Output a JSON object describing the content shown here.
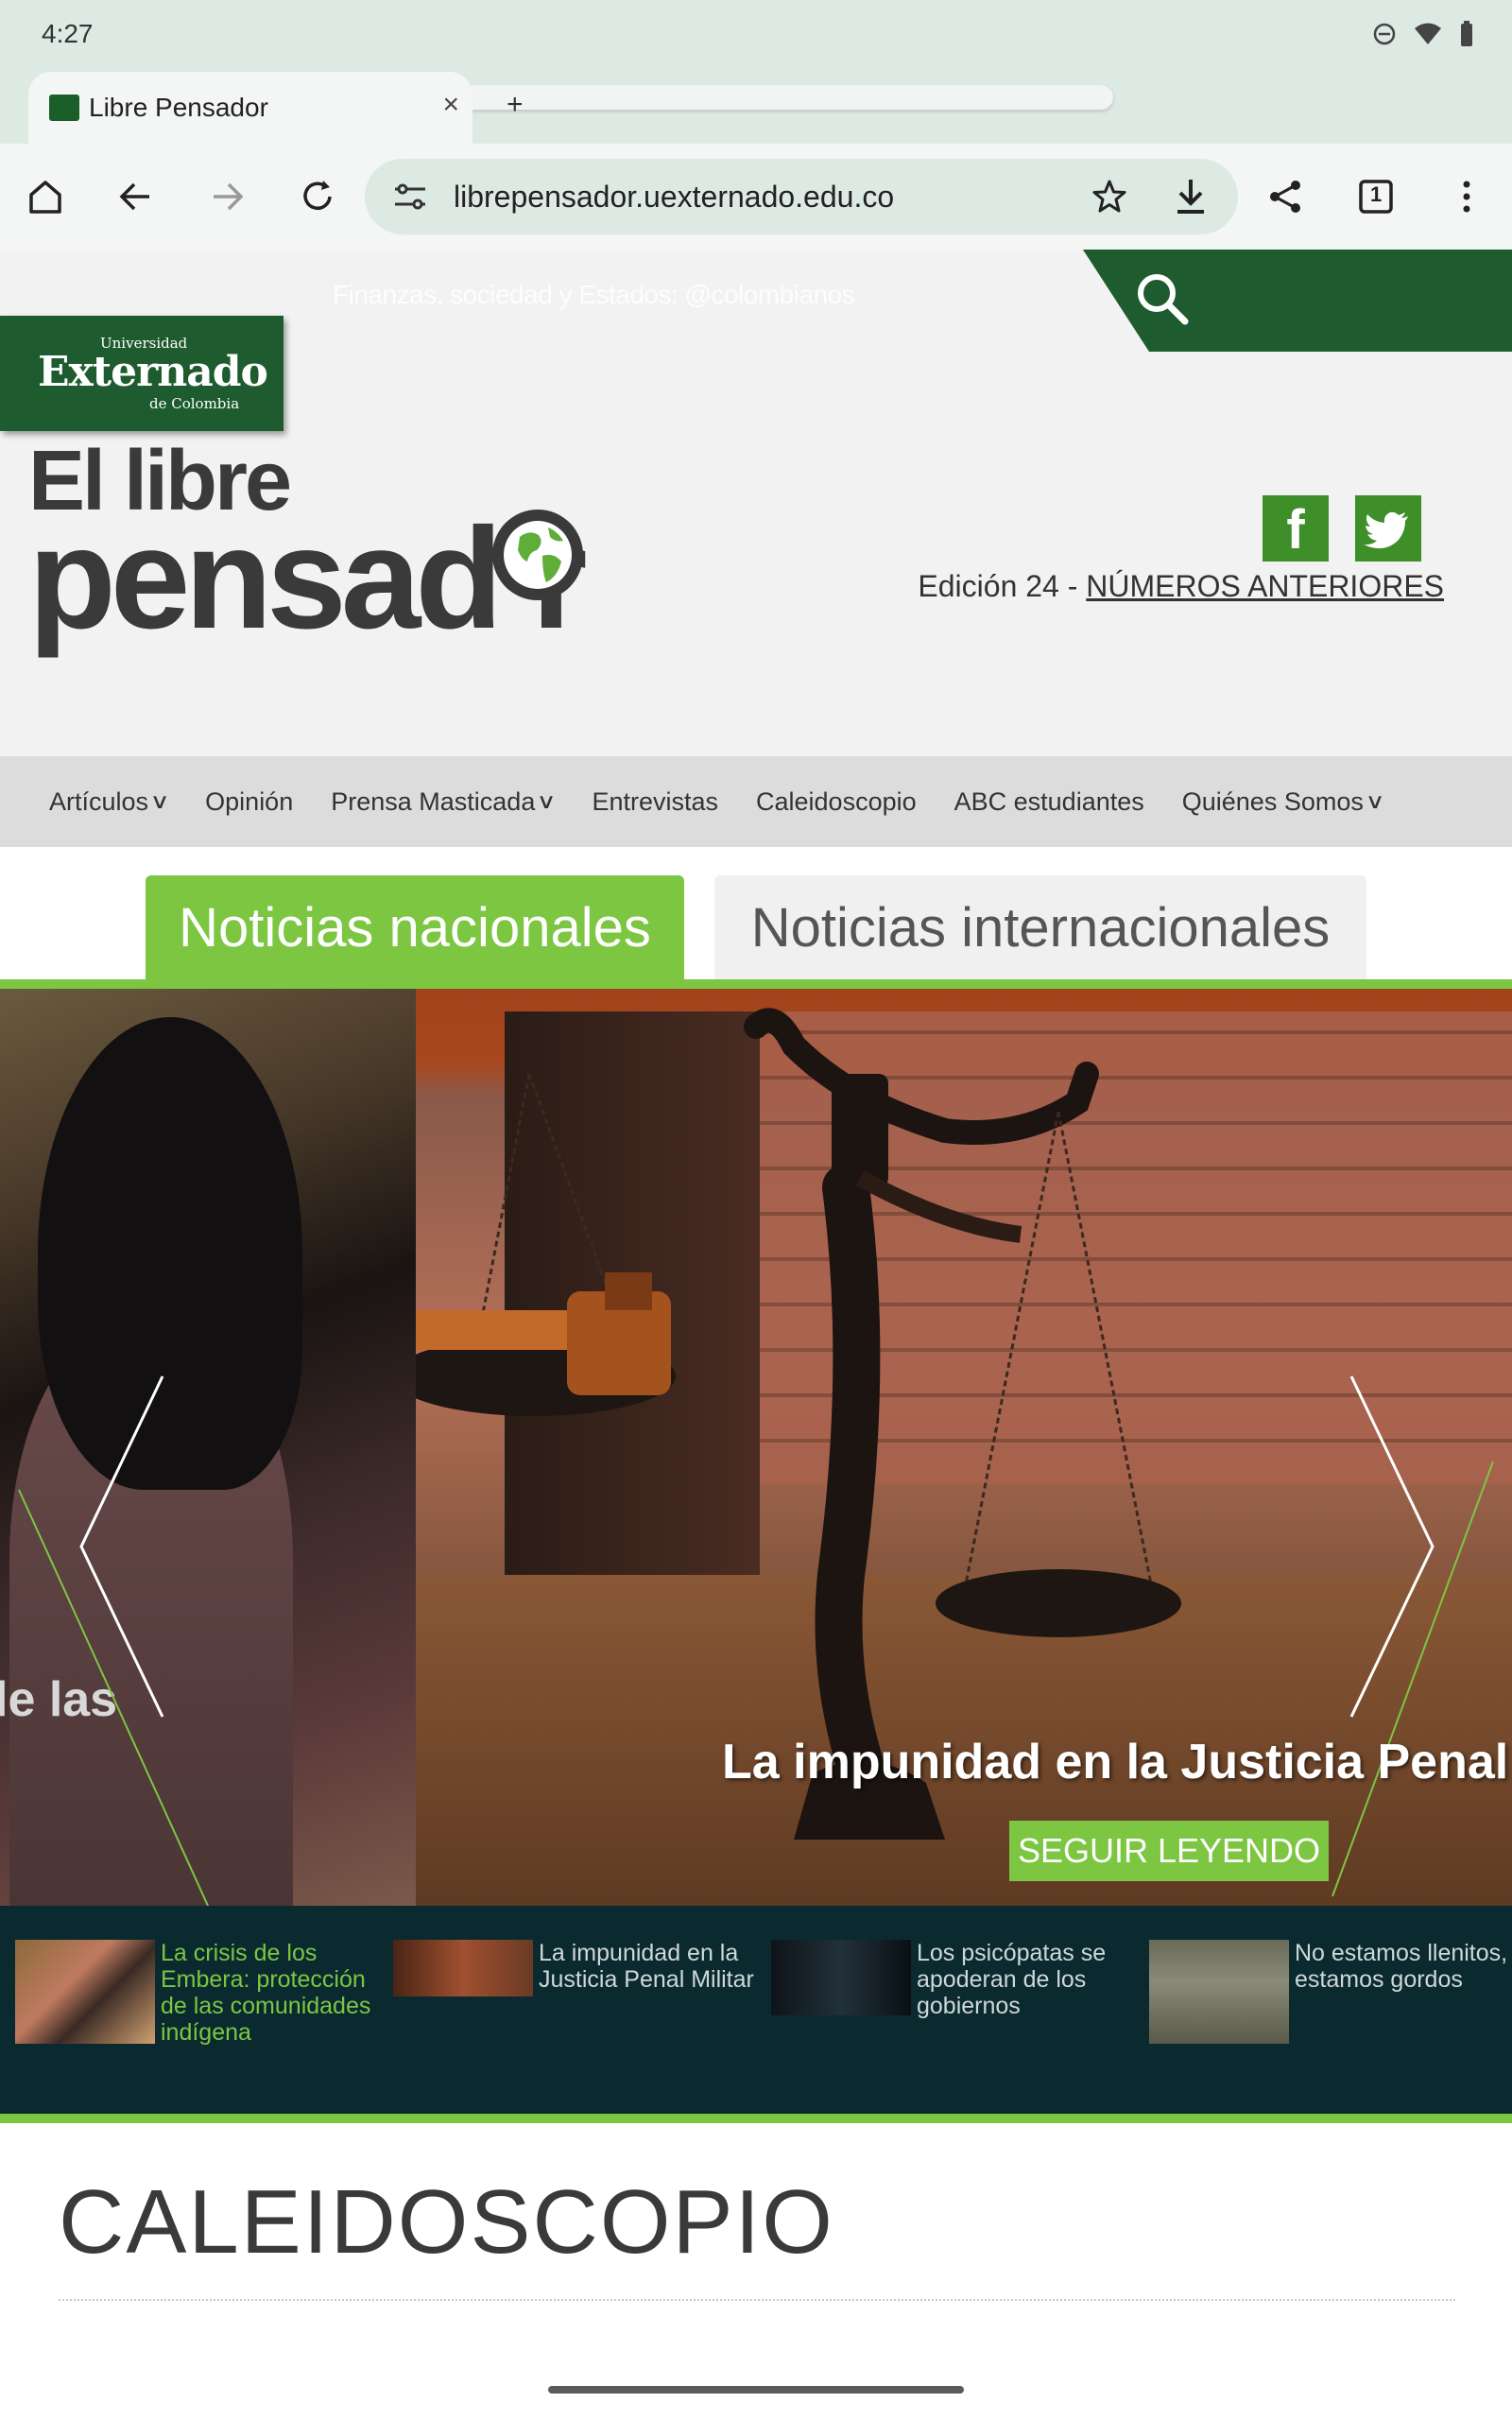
{
  "status": {
    "time": "4:27"
  },
  "browser": {
    "tab_title": "Libre Pensador",
    "tab_close": "×",
    "new_tab": "+",
    "url": "librepensador.uexternado.edu.co",
    "tab_count": "1"
  },
  "site": {
    "ticker": "Finanzas, sociedad y Estados: @colombianos",
    "uni": {
      "small": "Universidad",
      "big": "Externado",
      "sub": "de Colombia"
    },
    "brand_line1": "El libre",
    "brand_line2": "pensad r",
    "edition_prefix": "Edición 24 - ",
    "edition_link": "NÚMEROS ANTERIORES",
    "facebook": "f"
  },
  "nav": {
    "items": [
      {
        "label": "Artículos",
        "caret": true
      },
      {
        "label": "Opinión",
        "caret": false
      },
      {
        "label": "Prensa Masticada",
        "caret": true
      },
      {
        "label": "Entrevistas",
        "caret": false
      },
      {
        "label": "Caleidoscopio",
        "caret": false
      },
      {
        "label": "ABC estudiantes",
        "caret": false
      },
      {
        "label": "Quiénes Somos",
        "caret": true
      }
    ]
  },
  "news_tabs": {
    "active": "Noticias nacionales",
    "inactive": "Noticias internacionales"
  },
  "slider": {
    "side_text": "le las",
    "caption": "La impunidad en la Justicia Penal M",
    "button": "SEGUIR LEYENDO"
  },
  "thumbnails": [
    {
      "text": "La crisis de los Embera: protección de las comunidades indígena",
      "active": true
    },
    {
      "text": "La impunidad en la Justicia Penal Militar",
      "active": false
    },
    {
      "text": "Los psicópatas se apoderan de los gobiernos",
      "active": false
    },
    {
      "text": "No estamos llenitos, estamos gordos",
      "active": false
    }
  ],
  "section": {
    "title": "CALEIDOSCOPIO"
  },
  "colors": {
    "brand_green": "#7cc642",
    "dark_green": "#1e5b2e",
    "thumb_bg": "#0b2a30"
  }
}
